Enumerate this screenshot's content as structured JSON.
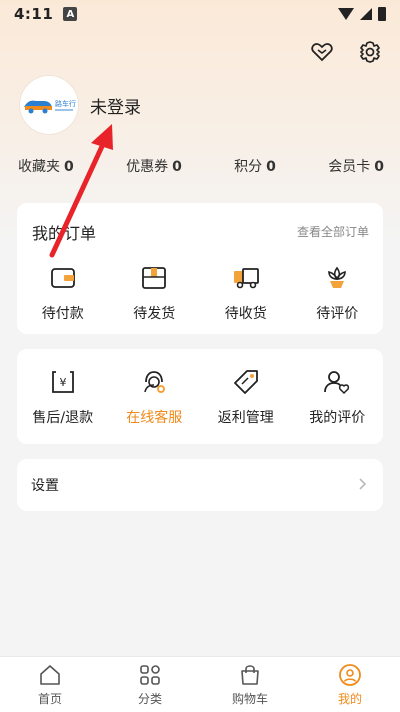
{
  "status_bar": {
    "time": "4:11",
    "notif_badge": "A"
  },
  "profile": {
    "login_text": "未登录",
    "logo_text": "路车行"
  },
  "stats": [
    {
      "label": "收藏夹",
      "value": "0"
    },
    {
      "label": "优惠券",
      "value": "0"
    },
    {
      "label": "积分",
      "value": "0"
    },
    {
      "label": "会员卡",
      "value": "0"
    }
  ],
  "orders": {
    "title": "我的订单",
    "view_all": "查看全部订单",
    "items": [
      {
        "label": "待付款",
        "icon": "wallet-icon"
      },
      {
        "label": "待发货",
        "icon": "package-icon"
      },
      {
        "label": "待收货",
        "icon": "truck-icon"
      },
      {
        "label": "待评价",
        "icon": "flower-icon"
      }
    ]
  },
  "services": {
    "items": [
      {
        "label": "售后/退款",
        "icon": "refund-icon"
      },
      {
        "label": "在线客服",
        "icon": "support-icon"
      },
      {
        "label": "返利管理",
        "icon": "tag-icon"
      },
      {
        "label": "我的评价",
        "icon": "user-heart-icon"
      }
    ]
  },
  "settings": {
    "label": "设置"
  },
  "tabbar": [
    {
      "label": "首页",
      "icon": "home-icon"
    },
    {
      "label": "分类",
      "icon": "category-icon"
    },
    {
      "label": "购物车",
      "icon": "cart-icon"
    },
    {
      "label": "我的",
      "icon": "profile-icon"
    }
  ],
  "colors": {
    "accent": "#f08a1a",
    "arrow": "#e8232a",
    "icon_orange": "#f3a33a"
  }
}
